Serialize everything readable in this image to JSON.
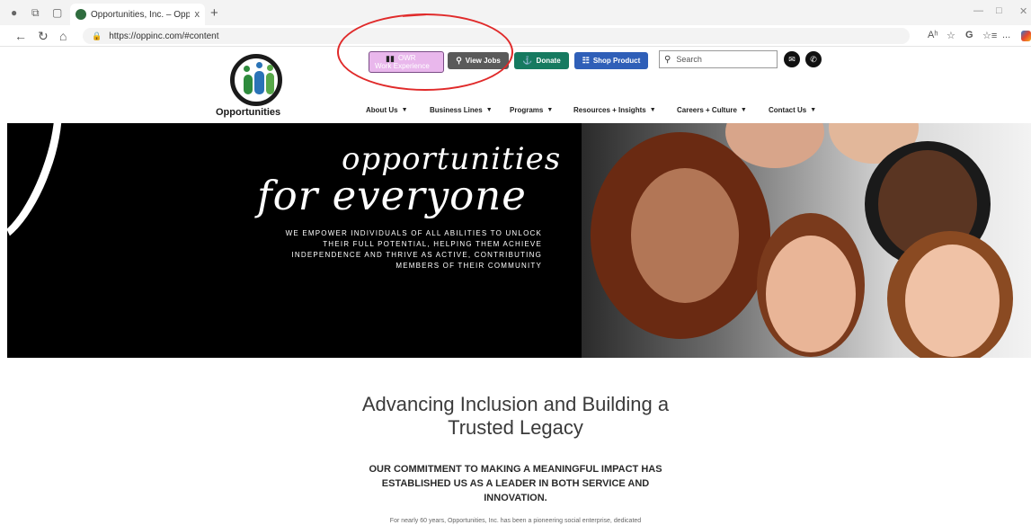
{
  "browser": {
    "tab_title": "Opportunities, Inc. – Opportuniti",
    "tab_close": "x",
    "new_tab": "+",
    "url": "https://oppinc.com/#content",
    "right_icons": [
      "Aʰ",
      "☆",
      "G",
      "☆≡",
      "..."
    ]
  },
  "site": {
    "logo_text": "Opportunities",
    "buttons": {
      "owe_line1": "OWR",
      "owe_line2": "Work Experience",
      "view_jobs": "View Jobs",
      "donate": "Donate",
      "shop": "Shop Product"
    },
    "search_placeholder": "Search",
    "nav": [
      {
        "label": "About Us"
      },
      {
        "label": "Business Lines"
      },
      {
        "label": "Programs"
      },
      {
        "label": "Resources + Insights"
      },
      {
        "label": "Careers + Culture"
      },
      {
        "label": "Contact Us"
      }
    ]
  },
  "hero": {
    "script_line1": "opportunities",
    "script_line2": "for everyone",
    "tagline_1": "WE EMPOWER INDIVIDUALS OF ALL ABILITIES TO UNLOCK",
    "tagline_2": "THEIR FULL POTENTIAL, HELPING THEM ACHIEVE",
    "tagline_3": "INDEPENDENCE AND THRIVE AS ACTIVE, CONTRIBUTING",
    "tagline_4": "MEMBERS OF THEIR COMMUNITY"
  },
  "content": {
    "heading_1": "Advancing Inclusion and Building a",
    "heading_2": "Trusted Legacy",
    "sub_1": "OUR COMMITMENT TO MAKING A MEANINGFUL IMPACT HAS",
    "sub_2": "ESTABLISHED US AS A LEADER IN BOTH SERVICE AND",
    "sub_3": "INNOVATION.",
    "paragraph": "For nearly 60 years, Opportunities, Inc. has been a pioneering social enterprise, dedicated"
  },
  "colors": {
    "donate": "#167a60",
    "shop": "#2f5fb8",
    "view_jobs": "#5a5a5a",
    "owe": "#e9b7ec",
    "annotation": "#e02a2a"
  }
}
